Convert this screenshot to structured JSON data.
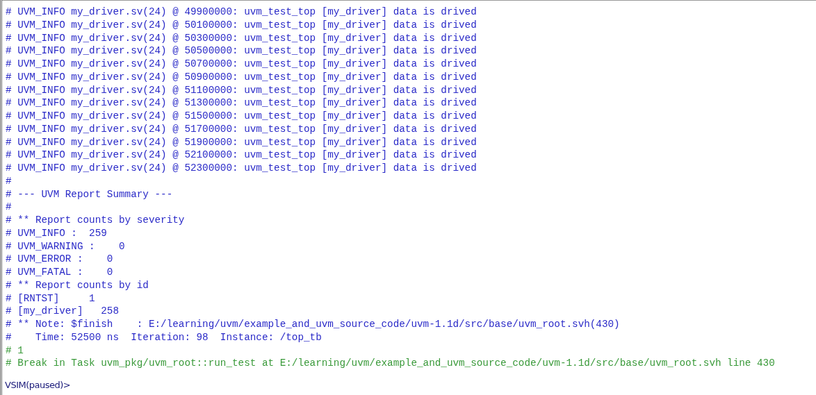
{
  "transcript": {
    "lines": [
      {
        "text": "# UVM_INFO my_driver.sv(24) @ 49900000: uvm_test_top [my_driver] data is drived",
        "color": "#2a2ac8"
      },
      {
        "text": "# UVM_INFO my_driver.sv(24) @ 50100000: uvm_test_top [my_driver] data is drived",
        "color": "#2a2ac8"
      },
      {
        "text": "# UVM_INFO my_driver.sv(24) @ 50300000: uvm_test_top [my_driver] data is drived",
        "color": "#2a2ac8"
      },
      {
        "text": "# UVM_INFO my_driver.sv(24) @ 50500000: uvm_test_top [my_driver] data is drived",
        "color": "#2a2ac8"
      },
      {
        "text": "# UVM_INFO my_driver.sv(24) @ 50700000: uvm_test_top [my_driver] data is drived",
        "color": "#2a2ac8"
      },
      {
        "text": "# UVM_INFO my_driver.sv(24) @ 50900000: uvm_test_top [my_driver] data is drived",
        "color": "#2a2ac8"
      },
      {
        "text": "# UVM_INFO my_driver.sv(24) @ 51100000: uvm_test_top [my_driver] data is drived",
        "color": "#2a2ac8"
      },
      {
        "text": "# UVM_INFO my_driver.sv(24) @ 51300000: uvm_test_top [my_driver] data is drived",
        "color": "#2a2ac8"
      },
      {
        "text": "# UVM_INFO my_driver.sv(24) @ 51500000: uvm_test_top [my_driver] data is drived",
        "color": "#2a2ac8"
      },
      {
        "text": "# UVM_INFO my_driver.sv(24) @ 51700000: uvm_test_top [my_driver] data is drived",
        "color": "#2a2ac8"
      },
      {
        "text": "# UVM_INFO my_driver.sv(24) @ 51900000: uvm_test_top [my_driver] data is drived",
        "color": "#2a2ac8"
      },
      {
        "text": "# UVM_INFO my_driver.sv(24) @ 52100000: uvm_test_top [my_driver] data is drived",
        "color": "#2a2ac8"
      },
      {
        "text": "# UVM_INFO my_driver.sv(24) @ 52300000: uvm_test_top [my_driver] data is drived",
        "color": "#2a2ac8"
      },
      {
        "text": "#",
        "color": "#2a2ac8"
      },
      {
        "text": "# --- UVM Report Summary ---",
        "color": "#2a2ac8"
      },
      {
        "text": "#",
        "color": "#2a2ac8"
      },
      {
        "text": "# ** Report counts by severity",
        "color": "#2a2ac8"
      },
      {
        "text": "# UVM_INFO :  259",
        "color": "#2a2ac8"
      },
      {
        "text": "# UVM_WARNING :    0",
        "color": "#2a2ac8"
      },
      {
        "text": "# UVM_ERROR :    0",
        "color": "#2a2ac8"
      },
      {
        "text": "# UVM_FATAL :    0",
        "color": "#2a2ac8"
      },
      {
        "text": "# ** Report counts by id",
        "color": "#2a2ac8"
      },
      {
        "text": "# [RNTST]     1",
        "color": "#2a2ac8"
      },
      {
        "text": "# [my_driver]   258",
        "color": "#2a2ac8"
      },
      {
        "text": "# ** Note: $finish    : E:/learning/uvm/example_and_uvm_source_code/uvm-1.1d/src/base/uvm_root.svh(430)",
        "color": "#2a2ac8"
      },
      {
        "text": "#    Time: 52500 ns  Iteration: 98  Instance: /top_tb",
        "color": "#2a2ac8"
      },
      {
        "text": "# 1",
        "color": "#3a9a3a"
      },
      {
        "text": "# Break in Task uvm_pkg/uvm_root::run_test at E:/learning/uvm/example_and_uvm_source_code/uvm-1.1d/src/base/uvm_root.svh line 430",
        "color": "#3a9a3a"
      }
    ]
  },
  "prompt": "VSIM(paused)>"
}
